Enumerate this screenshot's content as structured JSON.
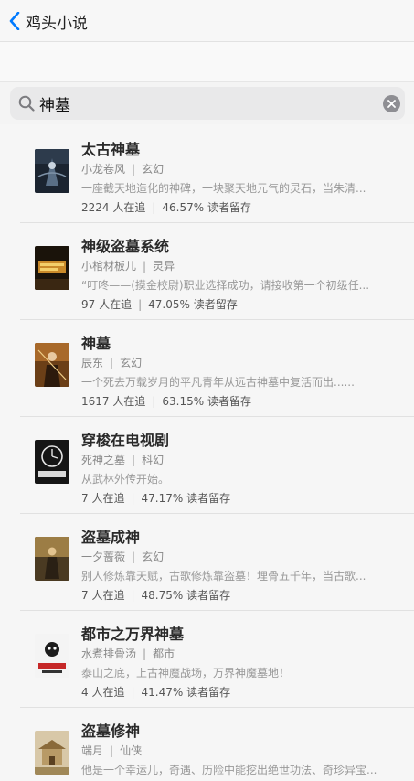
{
  "nav": {
    "back_label": "鸡头小说"
  },
  "search": {
    "value": "神墓"
  },
  "colors": {
    "accent": "#007aff",
    "background": "#f6f6f6"
  },
  "results": [
    {
      "title": "太古神墓",
      "author": "小龙卷风",
      "genre": "玄幻",
      "desc": "一座截天地造化的神碑，一块聚天地元气的灵石，当朱清...",
      "followers": "2224 人在追",
      "retention": "46.57% 读者留存",
      "cover_icon": "book-cover-dark-icon"
    },
    {
      "title": "神级盗墓系统",
      "author": "小棺材板儿",
      "genre": "灵异",
      "desc": "“叮咚——(摸金校尉)职业选择成功，请接收第一个初级任...",
      "followers": "97 人在追",
      "retention": "47.05% 读者留存",
      "cover_icon": "book-cover-gold-icon"
    },
    {
      "title": "神墓",
      "author": "辰东",
      "genre": "玄幻",
      "desc": "一个死去万载岁月的平凡青年从远古神墓中复活而出......",
      "followers": "1617 人在追",
      "retention": "63.15% 读者留存",
      "cover_icon": "book-cover-warrior-icon"
    },
    {
      "title": "穿梭在电视剧",
      "author": "死神之墓",
      "genre": "科幻",
      "desc": "从武林外传开始。",
      "followers": "7 人在追",
      "retention": "47.17% 读者留存",
      "cover_icon": "book-cover-clock-icon"
    },
    {
      "title": "盗墓成神",
      "author": "一夕蔷薇",
      "genre": "玄幻",
      "desc": "别人修炼靠天赋，古歌修炼靠盗墓！埋骨五千年，当古歌...",
      "followers": "7 人在追",
      "retention": "48.75% 读者留存",
      "cover_icon": "book-cover-figure-icon"
    },
    {
      "title": "都市之万界神墓",
      "author": "水煮排骨汤",
      "genre": "都市",
      "desc": "泰山之底，上古神魔战场，万界神魔墓地！",
      "followers": "4 人在追",
      "retention": "41.47% 读者留存",
      "cover_icon": "book-cover-cartoon-icon"
    },
    {
      "title": "盗墓修神",
      "author": "端月",
      "genre": "仙侠",
      "desc": "他是一个幸运儿，奇遇、历险中能挖出绝世功法、奇珍异宝...",
      "followers": "",
      "retention": "",
      "cover_icon": "book-cover-palace-icon"
    }
  ]
}
